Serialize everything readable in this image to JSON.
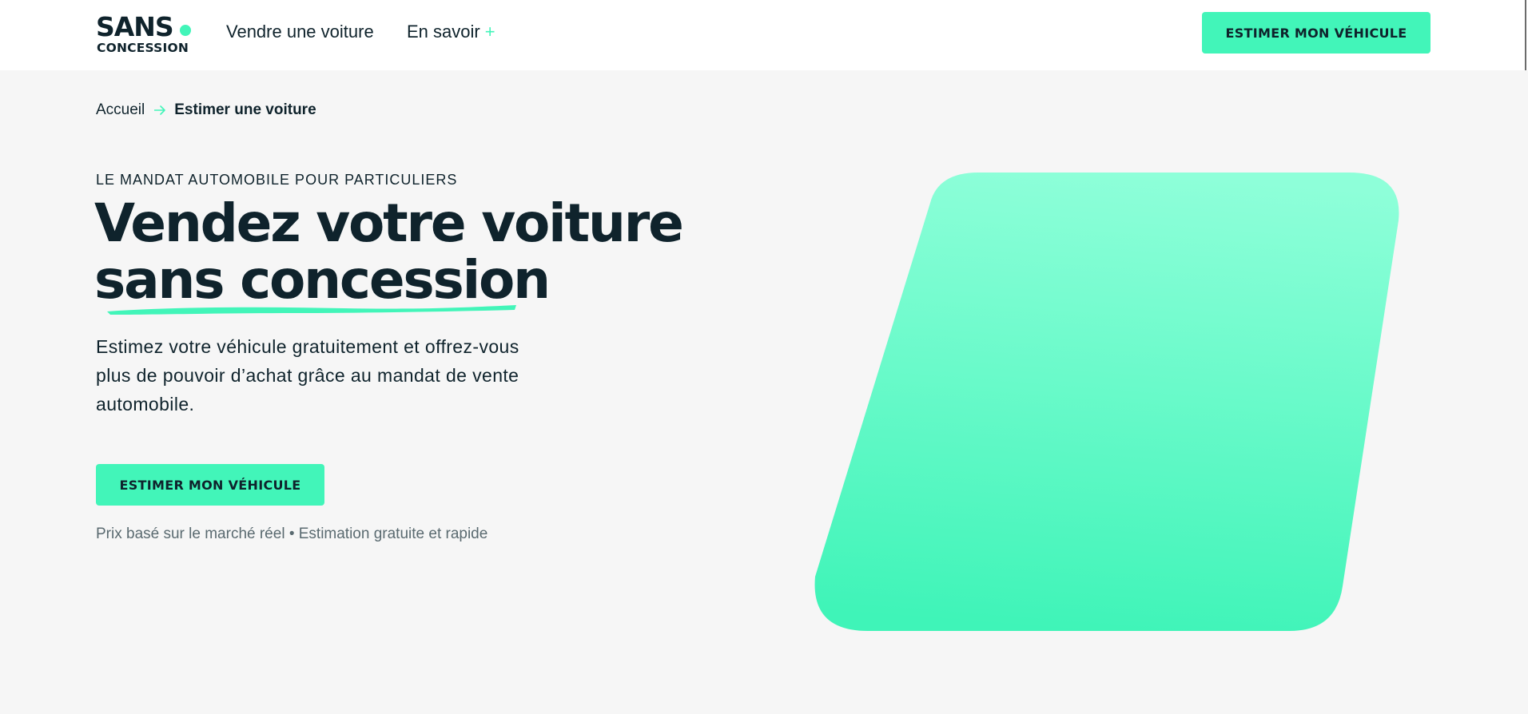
{
  "header": {
    "logo": {
      "line1": "SANS",
      "line2": "CONCESSION"
    },
    "nav": [
      {
        "label": "Vendre une voiture"
      },
      {
        "label": "En savoir",
        "expand_icon": "+"
      }
    ],
    "cta_label": "ESTIMER MON VÉHICULE"
  },
  "breadcrumb": {
    "home": "Accueil",
    "separator_icon": "arrow-right-icon",
    "current": "Estimer une voiture"
  },
  "hero": {
    "eyebrow": "LE MANDAT AUTOMOBILE POUR PARTICULIERS",
    "title_line1": "Vendez votre voiture",
    "title_line2": "sans concession",
    "description": "Estimez votre véhicule gratuitement et offrez-vous plus de pouvoir d’achat grâce au mandat de vente automobile.",
    "cta_label": "ESTIMER MON VÉHICULE",
    "note": "Prix basé sur le marché réel • Estimation gratuite et rapide"
  },
  "colors": {
    "accent": "#42f5b9",
    "text": "#0f232c",
    "background": "#f6f6f6",
    "shape_top": "#8effd9",
    "shape_bottom": "#3ff4b8"
  }
}
